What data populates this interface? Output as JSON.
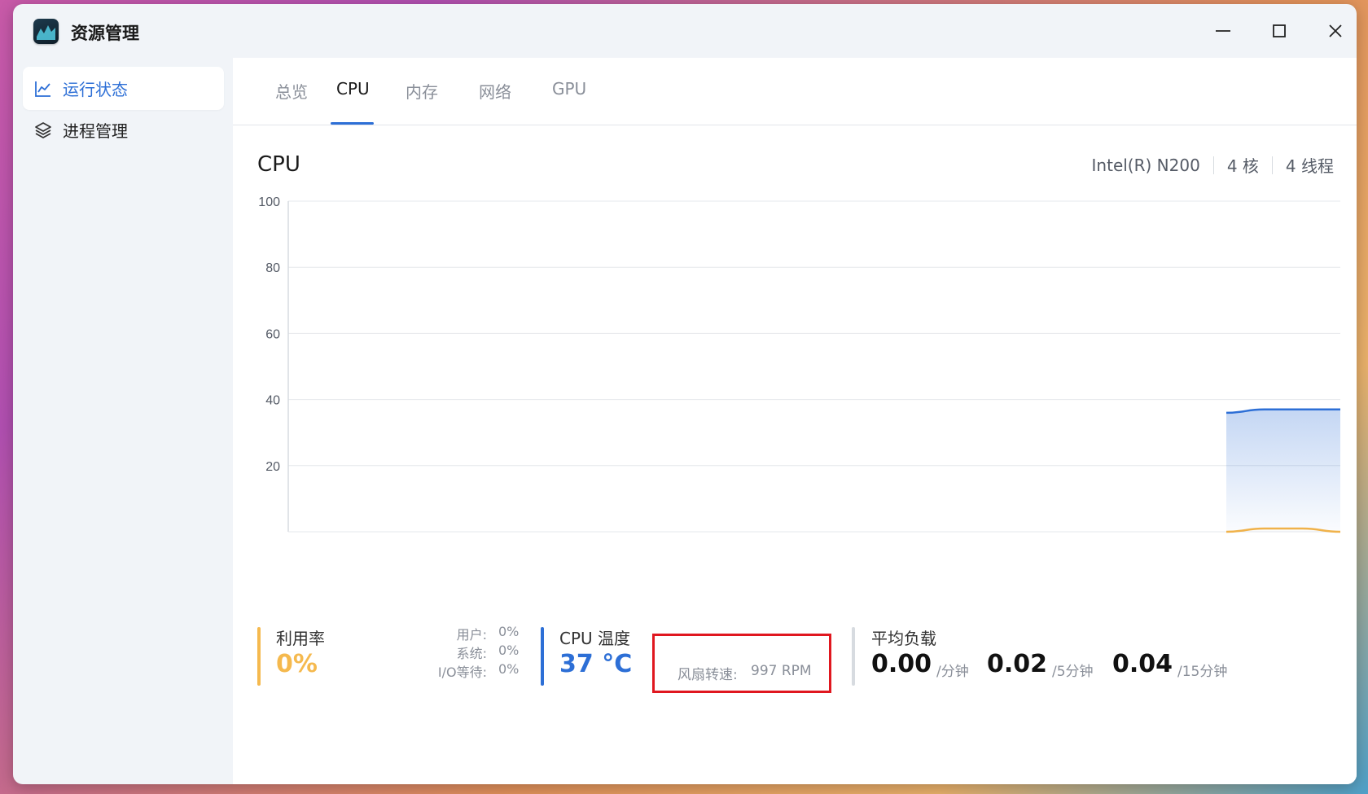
{
  "app": {
    "title": "资源管理",
    "icon": "activity-monitor-icon"
  },
  "window_controls": {
    "minimize": "minimize-icon",
    "maximize": "maximize-icon",
    "close": "close-icon"
  },
  "sidebar": {
    "items": [
      {
        "label": "运行状态",
        "icon": "line-chart-icon",
        "active": true
      },
      {
        "label": "进程管理",
        "icon": "layers-icon",
        "active": false
      }
    ]
  },
  "tabs": [
    {
      "label": "总览",
      "active": false
    },
    {
      "label": "CPU",
      "active": true
    },
    {
      "label": "内存",
      "active": false
    },
    {
      "label": "网络",
      "active": false
    },
    {
      "label": "GPU",
      "active": false
    }
  ],
  "section": {
    "title": "CPU",
    "model": "Intel(R) N200",
    "cores": "4 核",
    "threads": "4 线程"
  },
  "chart_data": {
    "type": "area",
    "ylim": [
      0,
      100
    ],
    "yticks": [
      "100",
      "80",
      "60",
      "40",
      "20"
    ],
    "grid": true,
    "series": [
      {
        "color": "#2d6fd6",
        "values": [
          36,
          37,
          37,
          37
        ]
      },
      {
        "color": "#f0b24a",
        "values": [
          0,
          1,
          1,
          0
        ]
      }
    ]
  },
  "stats": {
    "utilization": {
      "label": "利用率",
      "value": "0%",
      "color": "#f5b94e"
    },
    "breakdown": [
      {
        "key": "用户:",
        "value": "0%"
      },
      {
        "key": "系统:",
        "value": "0%"
      },
      {
        "key": "I/O等待:",
        "value": "0%"
      }
    ],
    "temperature": {
      "label": "CPU 温度",
      "value": "37 °C",
      "color": "#2d6fd6"
    },
    "fan": {
      "label": "风扇转速:",
      "value": "997 RPM"
    },
    "load": {
      "label": "平均负载",
      "values": [
        {
          "value": "0.00",
          "unit": "/分钟"
        },
        {
          "value": "0.02",
          "unit": "/5分钟"
        },
        {
          "value": "0.04",
          "unit": "/15分钟"
        }
      ]
    }
  }
}
